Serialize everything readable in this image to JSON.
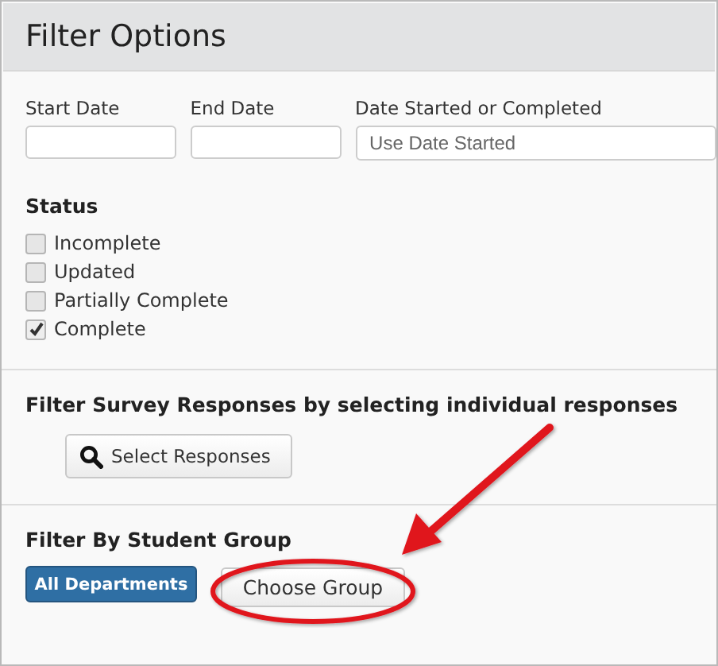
{
  "panel": {
    "title": "Filter Options"
  },
  "date_fields": [
    {
      "label": "Start Date",
      "kind": "input"
    },
    {
      "label": "End Date",
      "kind": "input"
    },
    {
      "label": "Date Started or Completed",
      "kind": "select",
      "value": "Use Date Started"
    }
  ],
  "status": {
    "heading": "Status",
    "options": [
      {
        "label": "Incomplete",
        "checked": false
      },
      {
        "label": "Updated",
        "checked": false
      },
      {
        "label": "Partially Complete",
        "checked": false
      },
      {
        "label": "Complete",
        "checked": true
      }
    ]
  },
  "responses_section": {
    "heading": "Filter Survey Responses by selecting individual responses",
    "button": "Select Responses"
  },
  "group_section": {
    "heading": "Filter By Student Group",
    "breadcrumb": "All Departments",
    "button": "Choose Group"
  }
}
